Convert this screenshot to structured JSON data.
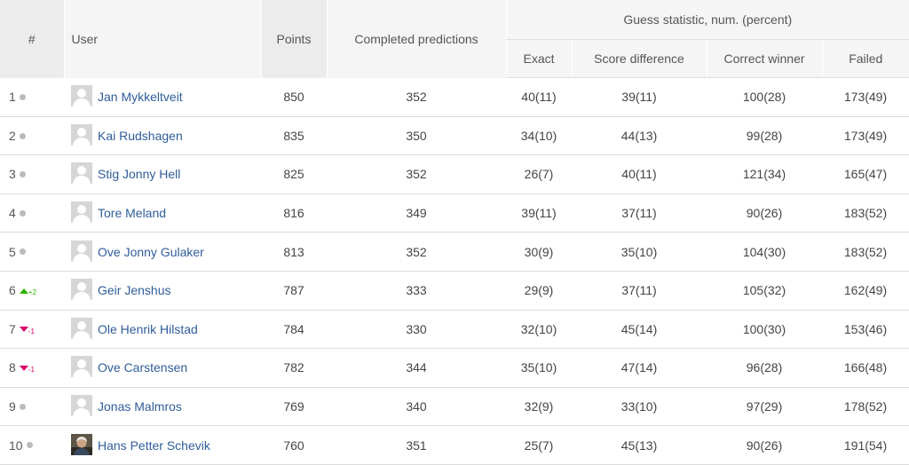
{
  "header": {
    "rank": "#",
    "user": "User",
    "points": "Points",
    "completed": "Completed predictions",
    "guess_group": "Guess statistic, num. (percent)",
    "exact": "Exact",
    "score_difference": "Score difference",
    "correct_winner": "Correct winner",
    "failed": "Failed"
  },
  "colors": {
    "up": "#2db300",
    "down": "#d9006c",
    "same": "#bbbbbb",
    "link": "#2f5d9a"
  },
  "rows": [
    {
      "rank": "1",
      "trend": "same",
      "change": "",
      "user": "Jan Mykkeltveit",
      "avatar": "default-avatar-icon",
      "points": "850",
      "completed": "352",
      "exact": "40(11)",
      "diff": "39(11)",
      "winner": "100(28)",
      "failed": "173(49)"
    },
    {
      "rank": "2",
      "trend": "same",
      "change": "",
      "user": "Kai Rudshagen",
      "avatar": "default-avatar-icon",
      "points": "835",
      "completed": "350",
      "exact": "34(10)",
      "diff": "44(13)",
      "winner": "99(28)",
      "failed": "173(49)"
    },
    {
      "rank": "3",
      "trend": "same",
      "change": "",
      "user": "Stig Jonny Hell",
      "avatar": "default-avatar-icon",
      "points": "825",
      "completed": "352",
      "exact": "26(7)",
      "diff": "40(11)",
      "winner": "121(34)",
      "failed": "165(47)"
    },
    {
      "rank": "4",
      "trend": "same",
      "change": "",
      "user": "Tore Meland",
      "avatar": "default-avatar-icon",
      "points": "816",
      "completed": "349",
      "exact": "39(11)",
      "diff": "37(11)",
      "winner": "90(26)",
      "failed": "183(52)"
    },
    {
      "rank": "5",
      "trend": "same",
      "change": "",
      "user": "Ove Jonny Gulaker",
      "avatar": "default-avatar-icon",
      "points": "813",
      "completed": "352",
      "exact": "30(9)",
      "diff": "35(10)",
      "winner": "104(30)",
      "failed": "183(52)"
    },
    {
      "rank": "6",
      "trend": "up",
      "change": "+2",
      "user": "Geir Jenshus",
      "avatar": "default-avatar-icon",
      "points": "787",
      "completed": "333",
      "exact": "29(9)",
      "diff": "37(11)",
      "winner": "105(32)",
      "failed": "162(49)"
    },
    {
      "rank": "7",
      "trend": "down",
      "change": "-1",
      "user": "Ole Henrik Hilstad",
      "avatar": "default-avatar-icon",
      "points": "784",
      "completed": "330",
      "exact": "32(10)",
      "diff": "45(14)",
      "winner": "100(30)",
      "failed": "153(46)"
    },
    {
      "rank": "8",
      "trend": "down",
      "change": "-1",
      "user": "Ove Carstensen",
      "avatar": "default-avatar-icon",
      "points": "782",
      "completed": "344",
      "exact": "35(10)",
      "diff": "47(14)",
      "winner": "96(28)",
      "failed": "166(48)"
    },
    {
      "rank": "9",
      "trend": "same",
      "change": "",
      "user": "Jonas Malmros",
      "avatar": "default-avatar-icon",
      "points": "769",
      "completed": "340",
      "exact": "32(9)",
      "diff": "33(10)",
      "winner": "97(29)",
      "failed": "178(52)"
    },
    {
      "rank": "10",
      "trend": "same",
      "change": "",
      "user": "Hans Petter Schevik",
      "avatar": "photo-avatar-icon",
      "points": "760",
      "completed": "351",
      "exact": "25(7)",
      "diff": "45(13)",
      "winner": "90(26)",
      "failed": "191(54)"
    }
  ]
}
